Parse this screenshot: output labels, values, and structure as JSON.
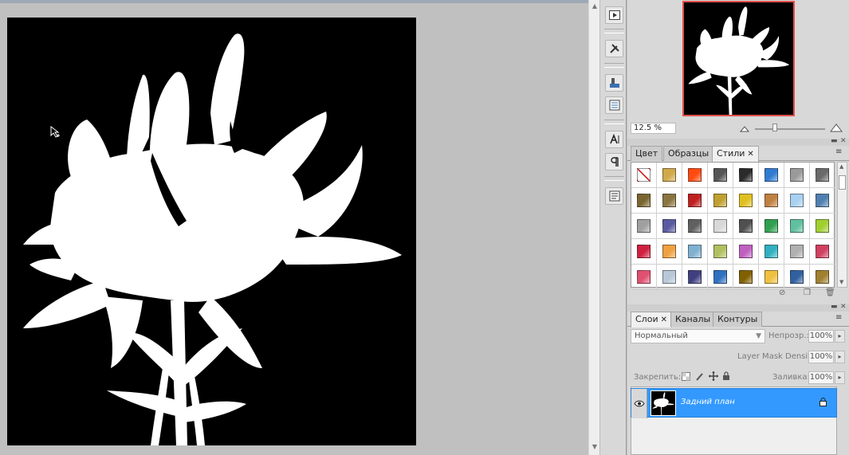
{
  "canvas": {
    "background": "#000000",
    "foreground": "#ffffff"
  },
  "navigator": {
    "zoom": "12.5 %",
    "zoom_level": 0.28,
    "frame_color": "#e0504f"
  },
  "styles_panel": {
    "tabs": [
      {
        "label": "Цвет"
      },
      {
        "label": "Образцы"
      },
      {
        "label": "Стили",
        "close": "✕"
      }
    ],
    "swatches": [
      "none",
      "#d1a84a",
      "#ff4a10",
      "#555555",
      "#2b2b2b",
      "#2f7bd1",
      "#9a9a9a",
      "#6a6a6a",
      "#7a6530",
      "#8a7540",
      "#c02020",
      "#c0a030",
      "#e0c020",
      "#c08040",
      "#a8d0f0",
      "#5080b0",
      "#a0a0a0",
      "#5a5aa0",
      "#606060",
      "#d8d8d8",
      "#505050",
      "#30a050",
      "#60c0a0",
      "#a0d030",
      "#d02040",
      "#f0a040",
      "#80b0d0",
      "#b0c060",
      "#c060c0",
      "#30b0c0",
      "#b0b0b0",
      "#d04060",
      "#e05070",
      "#b8c8d8",
      "#404080",
      "#3070c0",
      "#806000",
      "#f0c040",
      "#3060a0",
      "#a08030"
    ]
  },
  "layers_panel": {
    "tabs": [
      {
        "label": "Слои",
        "close": "✕"
      },
      {
        "label": "Каналы"
      },
      {
        "label": "Контуры"
      }
    ],
    "blend_mode": "Нормальный",
    "opacity_label": "Непрозр.:",
    "opacity_value": "100%",
    "mask_density_label": "Layer Mask Density",
    "mask_density_value": "100%",
    "lock_label": "Закрепить:",
    "fill_label": "Заливка:",
    "fill_value": "100%",
    "layer_name": "Задний план",
    "selected_color": "#3399ff"
  }
}
